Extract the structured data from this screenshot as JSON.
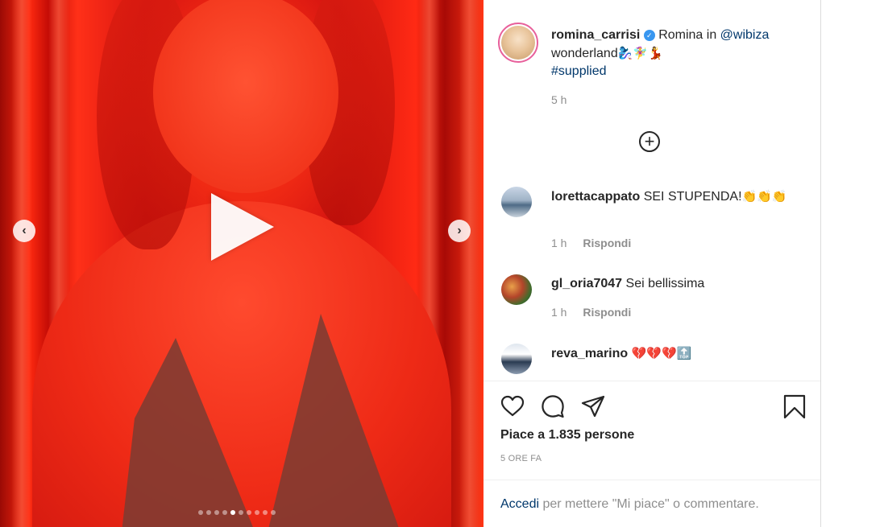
{
  "post": {
    "username": "romina_carrisi",
    "verified_symbol": "✓",
    "caption_text": "Romina in ",
    "caption_mention": "@wibiza",
    "caption_line2": "wonderland",
    "caption_emojis": "🧞‍♀️🧚‍♀️💃",
    "caption_hashtag": "#supplied",
    "time": "5 h"
  },
  "media": {
    "dots_total": 10,
    "dot_active_index": 4,
    "prev_glyph": "‹",
    "next_glyph": "›"
  },
  "load_more_glyph": "+",
  "comments": [
    {
      "username": "lorettacappato",
      "text": "SEI STUPENDA!",
      "emoji": "👏👏👏",
      "time": "1 h",
      "reply": "Rispondi"
    },
    {
      "username": "gl_oria7047",
      "text": "Sei bellissima",
      "emoji": "",
      "time": "1 h",
      "reply": "Rispondi"
    },
    {
      "username": "reva_marino",
      "text": "",
      "emoji": "💔💔💔🔝",
      "time": "",
      "reply": ""
    }
  ],
  "likes": "Piace a 1.835 persone",
  "posted_ago": "5 ORE FA",
  "login": {
    "link": "Accedi",
    "text": " per mettere \"Mi piace\" o commentare."
  },
  "icons": [
    "heart-icon",
    "comment-icon",
    "share-icon",
    "bookmark-icon",
    "play-icon",
    "plus-circle-icon",
    "chevron-left-icon",
    "chevron-right-icon",
    "verified-icon"
  ]
}
